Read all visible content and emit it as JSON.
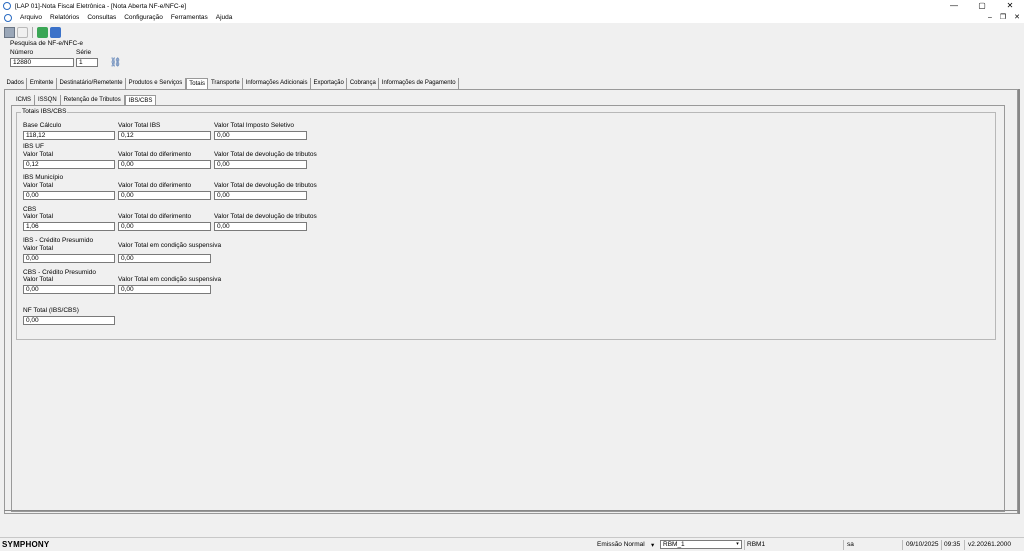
{
  "window": {
    "title": "[LAP 01]-Nota Fiscal Eletrônica - [Nota Aberta NF-e/NFC-e]",
    "controls": {
      "minimize": "—",
      "maximize": "▢",
      "close": "✕"
    }
  },
  "menu": {
    "items": [
      "Arquivo",
      "Relatórios",
      "Consultas",
      "Configuração",
      "Ferramentas",
      "Ajuda"
    ],
    "mdi": {
      "minimize": "–",
      "restore": "❐",
      "close": "✕"
    }
  },
  "toolbar": {
    "icons": [
      "save-icon",
      "undo-icon",
      "refresh-icon",
      "calculator-icon"
    ]
  },
  "search": {
    "title": "Pesquisa de NF-e/NFC-e",
    "numero_label": "Número",
    "numero_value": "12880",
    "serie_label": "Série",
    "serie_value": "1",
    "search_icon": "binoculars-icon"
  },
  "tabs": [
    "Dados",
    "Emitente",
    "Destinatário/Remetente",
    "Produtos e Serviços",
    "Totais",
    "Transporte",
    "Informações Adicionais",
    "Exportação",
    "Cobrança",
    "Informações de Pagamento"
  ],
  "active_tab": "Totais",
  "subtabs": [
    "ICMS",
    "ISSQN",
    "Retenção de Tributos",
    "IBS/CBS"
  ],
  "active_subtab": "IBS/CBS",
  "ibscbs": {
    "group_title": "Totais IBS/CBS",
    "base_calculo_label": "Base Cálculo",
    "base_calculo_value": "118,12",
    "valor_total_ibs_label": "Valor Total IBS",
    "valor_total_ibs_value": "0,12",
    "valor_total_seletivo_label": "Valor Total Imposto Seletivo",
    "valor_total_seletivo_value": "0,00",
    "ibs_uf": {
      "heading": "IBS UF",
      "total_label": "Valor Total",
      "total_value": "0,12",
      "diferimento_label": "Valor Total do diferimento",
      "diferimento_value": "0,00",
      "devolucao_label": "Valor Total de devolução de tributos",
      "devolucao_value": "0,00"
    },
    "ibs_mun": {
      "heading": "IBS Município",
      "total_label": "Valor Total",
      "total_value": "0,00",
      "diferimento_label": "Valor Total do diferimento",
      "diferimento_value": "0,00",
      "devolucao_label": "Valor Total de devolução de tributos",
      "devolucao_value": "0,00"
    },
    "cbs": {
      "heading": "CBS",
      "total_label": "Valor Total",
      "total_value": "1,06",
      "diferimento_label": "Valor Total do diferimento",
      "diferimento_value": "0,00",
      "devolucao_label": "Valor Total de devolução de tributos",
      "devolucao_value": "0,00"
    },
    "ibs_cp": {
      "heading": "IBS - Crédito Presumido",
      "total_label": "Valor Total",
      "total_value": "0,00",
      "suspensiva_label": "Valor Total em condição suspensiva",
      "suspensiva_value": "0,00"
    },
    "cbs_cp": {
      "heading": "CBS - Crédito Presumido",
      "total_label": "Valor Total",
      "total_value": "0,00",
      "suspensiva_label": "Valor Total em condição suspensiva",
      "suspensiva_value": "0,00"
    },
    "nf_total_label": "NF Total (IBS/CBS)",
    "nf_total_value": "0,00"
  },
  "status": {
    "brand": "SYMPHONY",
    "emissao": "Emissão Normal",
    "emissao_arrow": "▾",
    "combo_value": "RBM_1",
    "combo_arrow": "▾",
    "empresa": "RBM1",
    "user": "sa",
    "date": "09/10/2025",
    "time": "09:35",
    "version": "v2.20261.2000"
  },
  "colors": {
    "accent": "#2a6bc2",
    "panel": "#f0f0f0",
    "border": "#999999"
  }
}
